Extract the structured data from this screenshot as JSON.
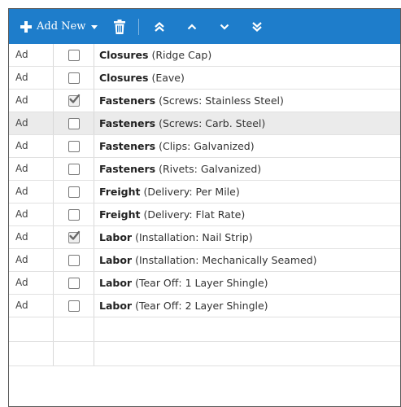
{
  "toolbar": {
    "add_new_label": "Add New",
    "background": "#1e7dcb",
    "icons": [
      "plus-icon",
      "caret-down-icon",
      "trash-icon",
      "double-chevron-up-icon",
      "chevron-up-icon",
      "chevron-down-icon",
      "double-chevron-down-icon"
    ]
  },
  "rows": [
    {
      "tag": "Ad",
      "checked": false,
      "name": "Closures",
      "detail": " (Ridge Cap)"
    },
    {
      "tag": "Ad",
      "checked": false,
      "name": "Closures",
      "detail": " (Eave)"
    },
    {
      "tag": "Ad",
      "checked": true,
      "name": "Fasteners",
      "detail": " (Screws: Stainless Steel)"
    },
    {
      "tag": "Ad",
      "checked": false,
      "name": "Fasteners",
      "detail": " (Screws: Carb. Steel)",
      "highlighted": true
    },
    {
      "tag": "Ad",
      "checked": false,
      "name": "Fasteners",
      "detail": " (Clips: Galvanized)"
    },
    {
      "tag": "Ad",
      "checked": false,
      "name": "Fasteners",
      "detail": " (Rivets: Galvanized)"
    },
    {
      "tag": "Ad",
      "checked": false,
      "name": "Freight",
      "detail": " (Delivery: Per Mile)"
    },
    {
      "tag": "Ad",
      "checked": false,
      "name": "Freight",
      "detail": " (Delivery: Flat Rate)"
    },
    {
      "tag": "Ad",
      "checked": true,
      "name": "Labor",
      "detail": " (Installation: Nail Strip)"
    },
    {
      "tag": "Ad",
      "checked": false,
      "name": "Labor",
      "detail": " (Installation: Mechanically Seamed)"
    },
    {
      "tag": "Ad",
      "checked": false,
      "name": "Labor",
      "detail": " (Tear Off: 1 Layer Shingle)"
    },
    {
      "tag": "Ad",
      "checked": false,
      "name": "Labor",
      "detail": " (Tear Off: 2 Layer Shingle)"
    }
  ]
}
